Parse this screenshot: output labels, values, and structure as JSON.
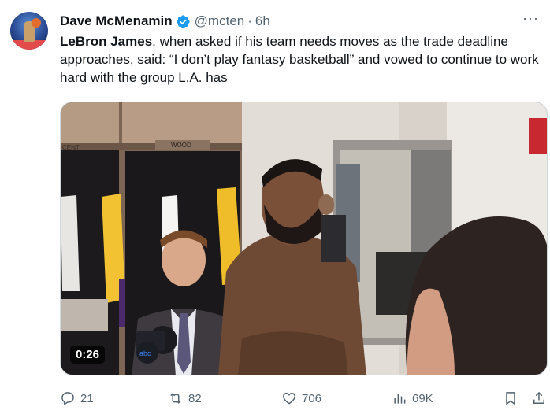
{
  "author": {
    "name": "Dave McMenamin",
    "handle": "@mcten",
    "separator": "·",
    "time": "6h",
    "more": "···"
  },
  "tweet": {
    "bold_lead": "LeBron James",
    "body": ", when asked if his team needs moves as the trade deadline approaches, said: “I don’t play fantasy basketball” and vowed to continue to work hard with the group L.A. has"
  },
  "media": {
    "duration": "0:26",
    "locker_plate_left": "CENT",
    "locker_plate_right": "WOOD"
  },
  "actions": {
    "replies": "21",
    "reposts": "82",
    "likes": "706",
    "views": "69K"
  },
  "colors": {
    "text": "#0f1419",
    "muted": "#536471",
    "verified_blue": "#1d9bf0"
  }
}
